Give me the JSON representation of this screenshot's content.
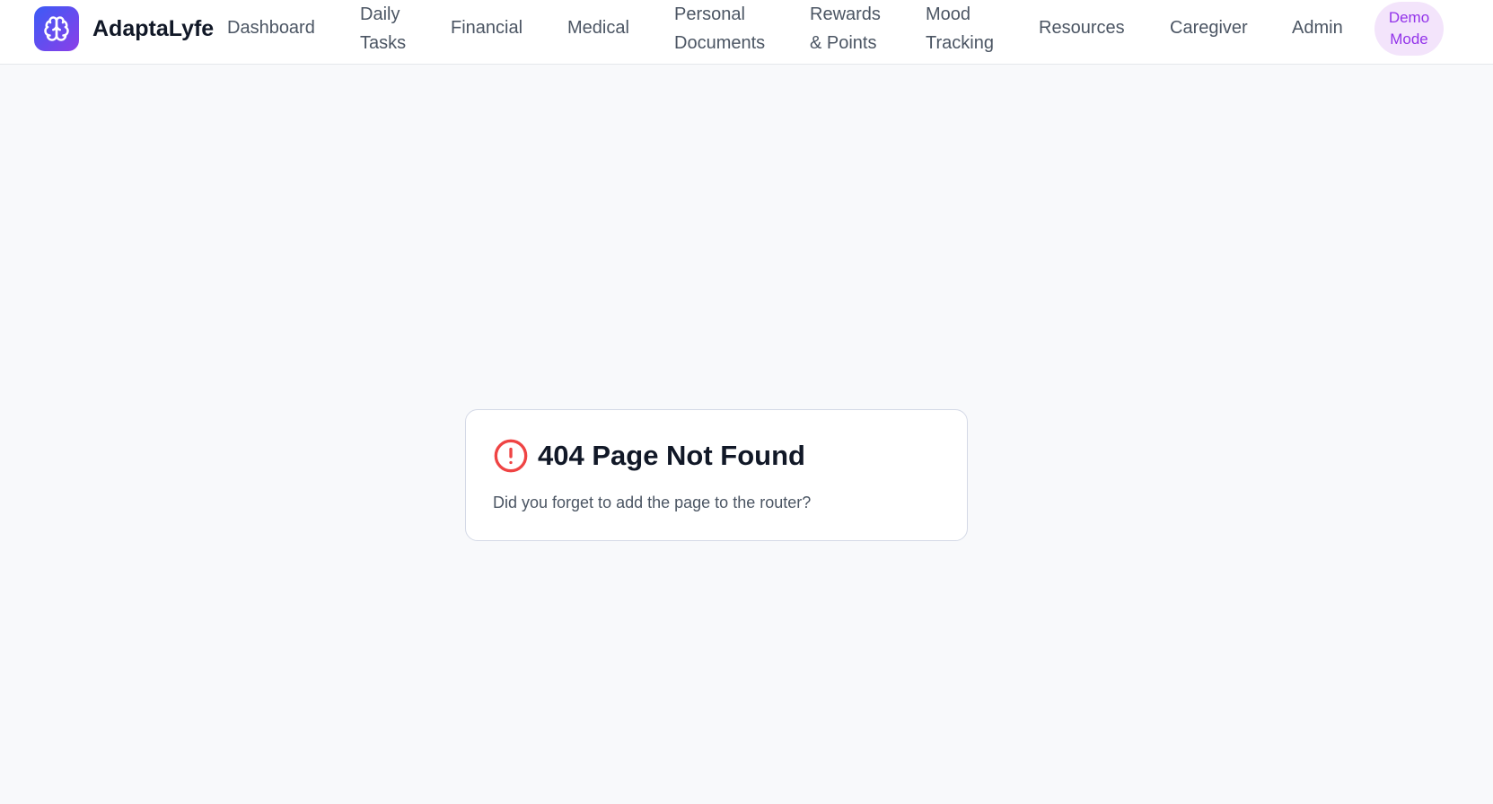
{
  "brand": {
    "name": "AdaptaLyfe",
    "logo_icon": "brain-icon",
    "gradient_start": "#3b5bf6",
    "gradient_end": "#8b3fe8"
  },
  "nav": {
    "items": [
      {
        "lines": [
          "Dashboard"
        ]
      },
      {
        "lines": [
          "Daily",
          "Tasks"
        ]
      },
      {
        "lines": [
          "Financial"
        ]
      },
      {
        "lines": [
          "Medical"
        ]
      },
      {
        "lines": [
          "Personal",
          "Documents"
        ]
      },
      {
        "lines": [
          "Rewards",
          "& Points"
        ]
      },
      {
        "lines": [
          "Mood",
          "Tracking"
        ]
      },
      {
        "lines": [
          "Resources"
        ]
      },
      {
        "lines": [
          "Caregiver"
        ]
      },
      {
        "lines": [
          "Admin"
        ]
      }
    ],
    "demo_badge": {
      "lines": [
        "Demo",
        "Mode"
      ],
      "color": "#9333ea",
      "background": "#f3e4fb"
    }
  },
  "error_card": {
    "icon": "alert-circle-icon",
    "icon_color": "#ef4444",
    "title": "404 Page Not Found",
    "message": "Did you forget to add the page to the router?"
  }
}
